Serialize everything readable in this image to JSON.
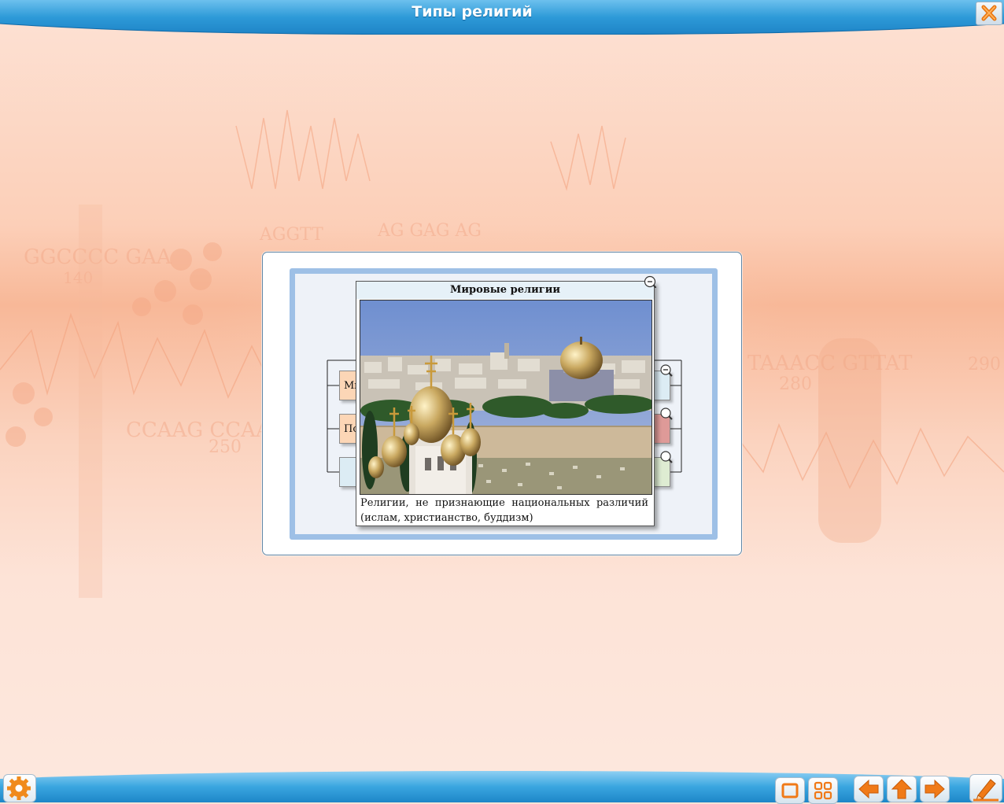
{
  "window": {
    "title": "Типы религий"
  },
  "popup": {
    "title": "Мировые религии",
    "description": "Религии, не признающие национальных различий (ислам, христианство, буддизм)",
    "photo_alt": "Jerusalem skyline with golden onion domes and the Dome of the Rock"
  },
  "diagram": {
    "boxes": [
      {
        "label": "Ми",
        "color": "#fcd6b6"
      },
      {
        "label": "По",
        "color": "#fcd6b6"
      },
      {
        "label": "",
        "color": "#dcecf4"
      }
    ],
    "right_boxes": [
      {
        "color": "#dcecf4"
      },
      {
        "color": "#de9a98"
      },
      {
        "color": "#deecd2"
      }
    ]
  },
  "toolbar": {
    "settings_icon": "gear-icon",
    "window_icon": "window-icon",
    "grid_icon": "grid-icon",
    "back_icon": "arrow-left-icon",
    "home_icon": "arrow-up-icon",
    "forward_icon": "arrow-right-icon",
    "pencil_icon": "pencil-icon"
  },
  "colors": {
    "titlebar": "#2b9ad8",
    "accent": "#f07a18"
  }
}
